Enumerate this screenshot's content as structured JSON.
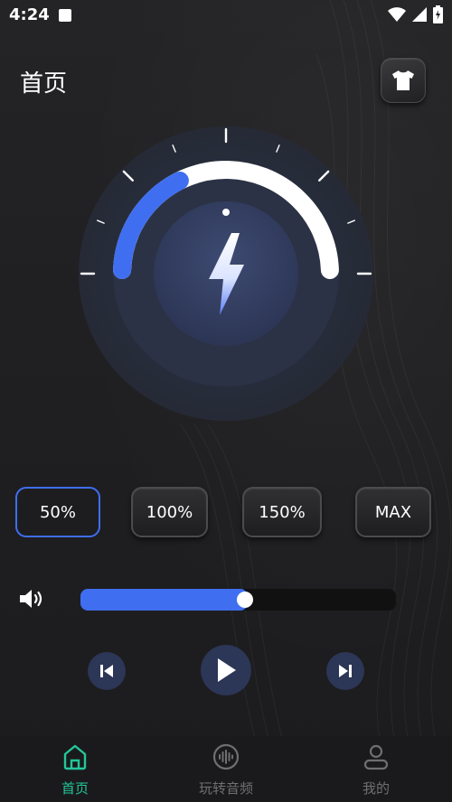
{
  "status_bar": {
    "time": "4:24"
  },
  "header": {
    "title": "首页",
    "theme_button_icon": "tshirt-icon"
  },
  "dial": {
    "level": 0.35,
    "center_icon": "lightning-bolt-icon"
  },
  "presets": [
    {
      "label": "50%",
      "active": true
    },
    {
      "label": "100%",
      "active": false
    },
    {
      "label": "150%",
      "active": false
    },
    {
      "label": "MAX",
      "active": false
    }
  ],
  "volume": {
    "icon": "speaker-icon",
    "level": 0.53
  },
  "playback": {
    "prev_icon": "skip-previous-icon",
    "play_icon": "play-icon",
    "next_icon": "skip-next-icon"
  },
  "bottom_nav": {
    "items": [
      {
        "label": "首页",
        "icon": "home-icon",
        "active": true
      },
      {
        "label": "玩转音频",
        "icon": "audio-wave-icon",
        "active": false
      },
      {
        "label": "我的",
        "icon": "user-icon",
        "active": false
      }
    ]
  },
  "colors": {
    "accent": "#3f6ef0",
    "nav_active": "#22c79a",
    "background": "#1e1e20"
  }
}
